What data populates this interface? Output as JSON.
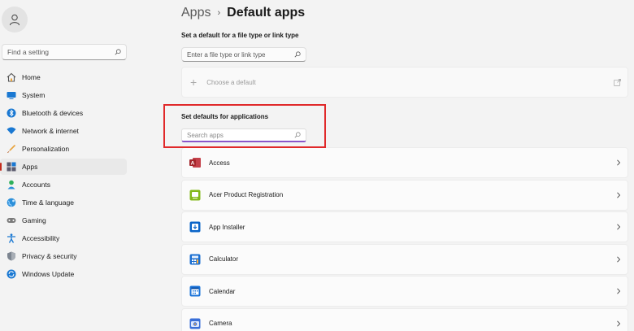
{
  "sidebar": {
    "search_placeholder": "Find a setting",
    "items": [
      {
        "label": "Home",
        "icon": "home-icon",
        "active": false
      },
      {
        "label": "System",
        "icon": "system-icon",
        "active": false
      },
      {
        "label": "Bluetooth & devices",
        "icon": "bluetooth-icon",
        "active": false
      },
      {
        "label": "Network & internet",
        "icon": "network-icon",
        "active": false
      },
      {
        "label": "Personalization",
        "icon": "brush-icon",
        "active": false
      },
      {
        "label": "Apps",
        "icon": "apps-icon",
        "active": true
      },
      {
        "label": "Accounts",
        "icon": "accounts-icon",
        "active": false
      },
      {
        "label": "Time & language",
        "icon": "globe-icon",
        "active": false
      },
      {
        "label": "Gaming",
        "icon": "gamepad-icon",
        "active": false
      },
      {
        "label": "Accessibility",
        "icon": "accessibility-icon",
        "active": false
      },
      {
        "label": "Privacy & security",
        "icon": "shield-icon",
        "active": false
      },
      {
        "label": "Windows Update",
        "icon": "update-icon",
        "active": false
      }
    ]
  },
  "header": {
    "parent": "Apps",
    "separator": "›",
    "current": "Default apps"
  },
  "filetype_section": {
    "title": "Set a default for a file type or link type",
    "placeholder": "Enter a file type or link type",
    "choose_default_label": "Choose a default",
    "plus_glyph": "+"
  },
  "apps_section": {
    "title": "Set defaults for applications",
    "placeholder": "Search apps",
    "apps": [
      {
        "name": "Access",
        "icon": "access-icon",
        "color": "#a4262c"
      },
      {
        "name": "Acer Product Registration",
        "icon": "acer-registration-icon",
        "color": "#83b81a"
      },
      {
        "name": "App Installer",
        "icon": "app-installer-icon",
        "color": "#0a64c8"
      },
      {
        "name": "Calculator",
        "icon": "calculator-icon",
        "color": "#1b6fd1"
      },
      {
        "name": "Calendar",
        "icon": "calendar-icon",
        "color": "#1a73d9"
      },
      {
        "name": "Camera",
        "icon": "camera-icon",
        "color": "#3a6fd8"
      }
    ]
  },
  "colors": {
    "accent": "#c42b1c",
    "highlight_box": "#e0292a",
    "search_underline": "#8a55c9"
  }
}
